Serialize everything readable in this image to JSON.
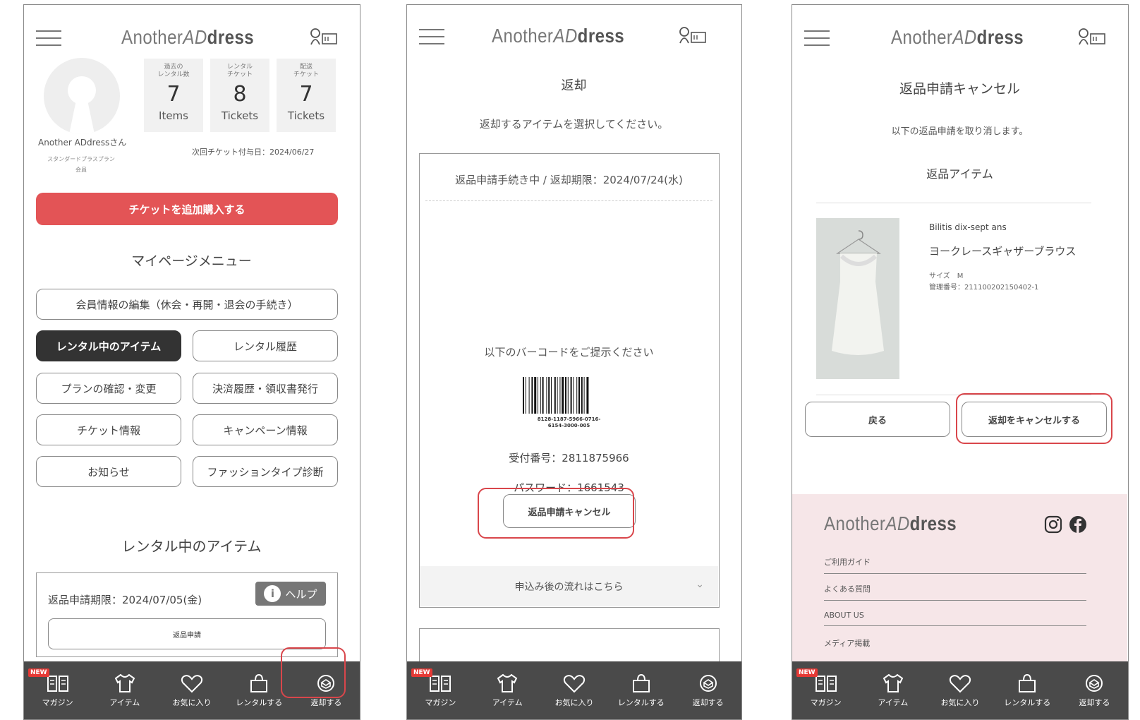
{
  "logo": {
    "pre": "Another",
    "mid": "AD",
    "post": "dress"
  },
  "tabs": [
    {
      "label": "マガジン",
      "badge": "NEW",
      "icon": "book-icon"
    },
    {
      "label": "アイテム",
      "icon": "shirt-icon"
    },
    {
      "label": "お気に入り",
      "icon": "heart-icon"
    },
    {
      "label": "レンタルする",
      "icon": "bag-icon"
    },
    {
      "label": "返却する",
      "icon": "return-icon"
    }
  ],
  "s1": {
    "stats": [
      {
        "label1": "過去の",
        "label2": "レンタル数",
        "value": "7",
        "unit": "Items"
      },
      {
        "label1": "レンタル",
        "label2": "チケット",
        "value": "8",
        "unit": "Tickets"
      },
      {
        "label1": "配送",
        "label2": "チケット",
        "value": "7",
        "unit": "Tickets"
      }
    ],
    "user_name": "Another ADdressさん",
    "plan": "スタンダードプラスプラン",
    "member": "会員",
    "next_ticket": "次回チケット付与日：2024/06/27",
    "buy_ticket": "チケットを追加購入する",
    "menu_title": "マイページメニュー",
    "menu": {
      "member_edit": "会員情報の編集（休会・再開・退会の手続き）",
      "renting": "レンタル中のアイテム",
      "history": "レンタル履歴",
      "plan": "プランの確認・変更",
      "payment": "決済履歴・領収書発行",
      "ticket": "チケット情報",
      "campaign": "キャンペーン情報",
      "news": "お知らせ",
      "diagnosis": "ファッションタイプ診断"
    },
    "section_title": "レンタル中のアイテム",
    "deadline": "返品申請期限：2024/07/05(金)",
    "help": "ヘルプ",
    "return_apply": "返品申請"
  },
  "s2": {
    "title": "返却",
    "subtitle": "返却するアイテムを選択してください。",
    "status": "返品申請手続き中 / 返却期限：2024/07/24(水)",
    "barcode_prompt": "以下のバーコードをご提示ください",
    "barcode_number1": "8128-1187-5966-0716-",
    "barcode_number2": "6154-3000-005",
    "receipt": "受付番号：2811875966",
    "password": "パスワード：1661543",
    "cancel_button": "返品申請キャンセル",
    "flow_link": "申込み後の流れはこちら"
  },
  "s3": {
    "title": "返品申請キャンセル",
    "subtitle": "以下の返品申請を取り消します。",
    "section": "返品アイテム",
    "brand": "Bilitis dix-sept ans",
    "item_name": "ヨークレースギャザーブラウス",
    "size": "サイズ　M",
    "manage_no": "管理番号：211100202150402-1",
    "back_button": "戻る",
    "cancel_button": "返却をキャンセルする",
    "footer_links": [
      "ご利用ガイド",
      "よくある質問",
      "ABOUT US",
      "メディア掲載"
    ]
  },
  "colors": {
    "accent_red": "#e35456",
    "dark": "#333333",
    "tabbar": "#4a4a4a",
    "footer_bg": "#f6e6e8",
    "highlight": "#d9464b"
  }
}
